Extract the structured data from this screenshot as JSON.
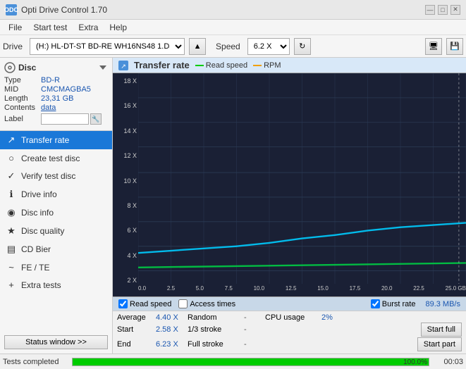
{
  "app": {
    "title": "Opti Drive Control 1.70",
    "icon": "ODC"
  },
  "title_controls": {
    "minimize": "—",
    "maximize": "□",
    "close": "✕"
  },
  "menu": {
    "items": [
      "File",
      "Start test",
      "Extra",
      "Help"
    ]
  },
  "toolbar": {
    "drive_label": "Drive",
    "drive_value": "(H:)  HL-DT-ST BD-RE  WH16NS48 1.D3",
    "speed_label": "Speed",
    "speed_value": "6.2 X"
  },
  "disc": {
    "section_title": "Disc",
    "type_label": "Type",
    "type_value": "BD-R",
    "mid_label": "MID",
    "mid_value": "CMCMAGBA5",
    "length_label": "Length",
    "length_value": "23,31 GB",
    "contents_label": "Contents",
    "contents_value": "data",
    "label_label": "Label",
    "label_value": ""
  },
  "nav": {
    "items": [
      {
        "id": "transfer-rate",
        "label": "Transfer rate",
        "icon": "↗",
        "active": true
      },
      {
        "id": "create-test-disc",
        "label": "Create test disc",
        "icon": "○"
      },
      {
        "id": "verify-test-disc",
        "label": "Verify test disc",
        "icon": "✓"
      },
      {
        "id": "drive-info",
        "label": "Drive info",
        "icon": "ℹ"
      },
      {
        "id": "disc-info",
        "label": "Disc info",
        "icon": "◉"
      },
      {
        "id": "disc-quality",
        "label": "Disc quality",
        "icon": "★"
      },
      {
        "id": "cd-bier",
        "label": "CD Bier",
        "icon": "▤"
      },
      {
        "id": "fe-te",
        "label": "FE / TE",
        "icon": "~"
      },
      {
        "id": "extra-tests",
        "label": "Extra tests",
        "icon": "+"
      }
    ]
  },
  "status_window_btn": "Status window >>",
  "chart": {
    "title": "Transfer rate",
    "legend": {
      "read_speed_label": "Read speed",
      "rpm_label": "RPM"
    },
    "y_axis": [
      "18 X",
      "16 X",
      "14 X",
      "12 X",
      "10 X",
      "8 X",
      "6 X",
      "4 X",
      "2 X"
    ],
    "x_axis": [
      "0.0",
      "2.5",
      "5.0",
      "7.5",
      "10.0",
      "12.5",
      "15.0",
      "17.5",
      "20.0",
      "22.5",
      "25.0 GB"
    ],
    "checkboxes": {
      "read_speed": {
        "label": "Read speed",
        "checked": true
      },
      "access_times": {
        "label": "Access times",
        "checked": false
      },
      "burst_rate": {
        "label": "Burst rate",
        "checked": true
      }
    },
    "burst_rate_value": "89.3 MB/s"
  },
  "stats": {
    "average_label": "Average",
    "average_value": "4.40 X",
    "random_label": "Random",
    "random_value": "-",
    "cpu_usage_label": "CPU usage",
    "cpu_usage_value": "2%",
    "start_label": "Start",
    "start_value": "2.58 X",
    "stroke_13_label": "1/3 stroke",
    "stroke_13_value": "-",
    "start_full_btn": "Start full",
    "end_label": "End",
    "end_value": "6.23 X",
    "full_stroke_label": "Full stroke",
    "full_stroke_value": "-",
    "start_part_btn": "Start part"
  },
  "status_bar": {
    "text": "Tests completed",
    "progress": 100,
    "progress_text": "100.0%",
    "time": "00:03"
  }
}
